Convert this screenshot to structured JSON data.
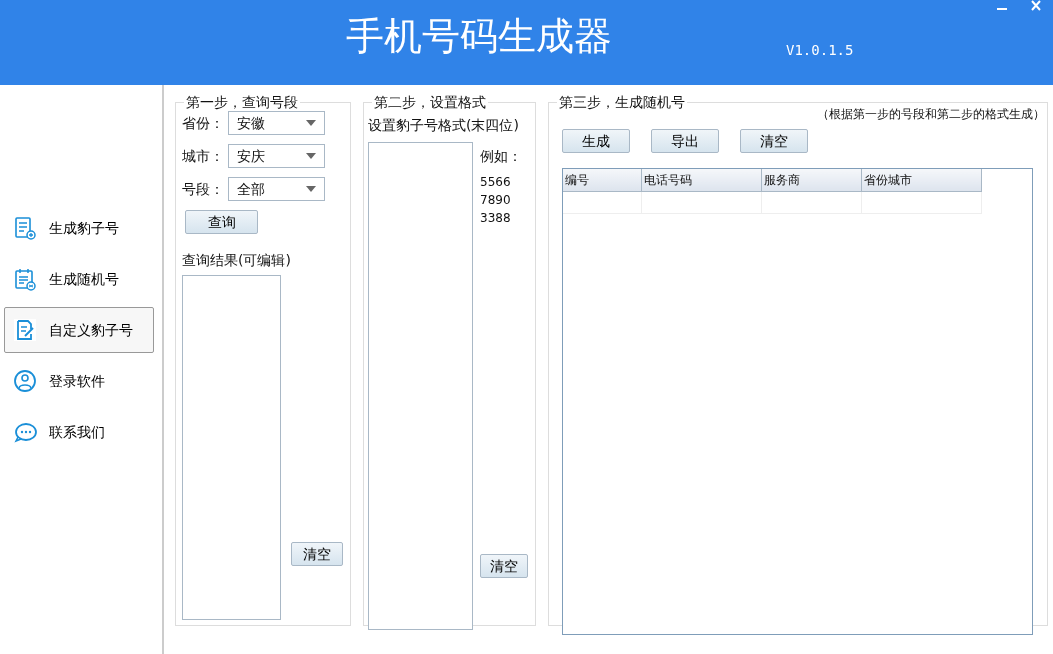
{
  "window": {
    "title": "手机号码生成器",
    "version": "V1.0.1.5"
  },
  "sidebar": {
    "items": [
      {
        "label": "生成豹子号",
        "selected": false
      },
      {
        "label": "生成随机号",
        "selected": false
      },
      {
        "label": "自定义豹子号",
        "selected": true
      },
      {
        "label": "登录软件",
        "selected": false
      },
      {
        "label": "联系我们",
        "selected": false
      }
    ]
  },
  "step1": {
    "title": "第一步，查询号段",
    "fields": [
      {
        "label": "省份：",
        "value": "安徽"
      },
      {
        "label": "城市：",
        "value": "安庆"
      },
      {
        "label": "号段：",
        "value": "全部"
      }
    ],
    "query_button": "查询",
    "result_label": "查询结果(可编辑)",
    "clear_button": "清空"
  },
  "step2": {
    "title": "第二步，设置格式",
    "format_label": "设置豹子号格式(末四位)",
    "example_label": "例如：",
    "examples": [
      "5566",
      "7890",
      "3388"
    ],
    "clear_button": "清空"
  },
  "step3": {
    "title": "第三步，生成随机号",
    "note": "（根据第一步的号段和第二步的格式生成）",
    "buttons": [
      "生成",
      "导出",
      "清空"
    ],
    "table": {
      "columns": [
        "编号",
        "电话号码",
        "服务商",
        "省份城市"
      ]
    }
  }
}
